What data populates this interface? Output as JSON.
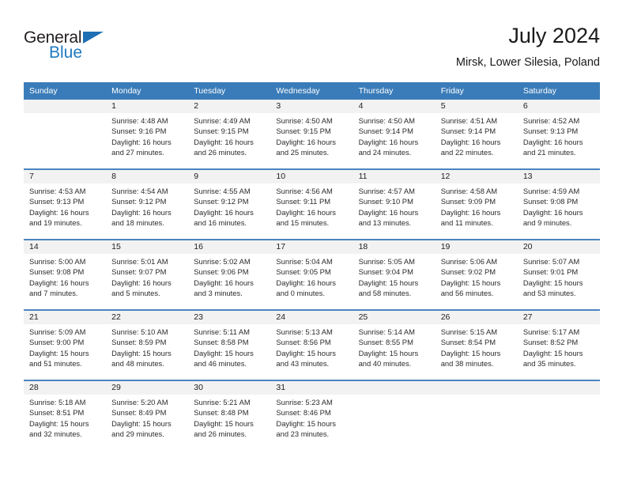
{
  "brand": {
    "name_top": "General",
    "name_bottom": "Blue",
    "triangle_color": "#1f6fb5",
    "blue_color": "#1f7ac0"
  },
  "header": {
    "title": "July 2024",
    "location": "Mirsk, Lower Silesia, Poland"
  },
  "theme": {
    "header_bg": "#3a7cb9",
    "row_rule": "#4a85bf",
    "daynum_bg": "#f2f2f2",
    "text": "#2b2b2b"
  },
  "weekdays": [
    "Sunday",
    "Monday",
    "Tuesday",
    "Wednesday",
    "Thursday",
    "Friday",
    "Saturday"
  ],
  "weeks": [
    [
      {
        "day": "",
        "sunrise": "",
        "sunset": "",
        "daylight1": "",
        "daylight2": ""
      },
      {
        "day": "1",
        "sunrise": "Sunrise: 4:48 AM",
        "sunset": "Sunset: 9:16 PM",
        "daylight1": "Daylight: 16 hours",
        "daylight2": "and 27 minutes."
      },
      {
        "day": "2",
        "sunrise": "Sunrise: 4:49 AM",
        "sunset": "Sunset: 9:15 PM",
        "daylight1": "Daylight: 16 hours",
        "daylight2": "and 26 minutes."
      },
      {
        "day": "3",
        "sunrise": "Sunrise: 4:50 AM",
        "sunset": "Sunset: 9:15 PM",
        "daylight1": "Daylight: 16 hours",
        "daylight2": "and 25 minutes."
      },
      {
        "day": "4",
        "sunrise": "Sunrise: 4:50 AM",
        "sunset": "Sunset: 9:14 PM",
        "daylight1": "Daylight: 16 hours",
        "daylight2": "and 24 minutes."
      },
      {
        "day": "5",
        "sunrise": "Sunrise: 4:51 AM",
        "sunset": "Sunset: 9:14 PM",
        "daylight1": "Daylight: 16 hours",
        "daylight2": "and 22 minutes."
      },
      {
        "day": "6",
        "sunrise": "Sunrise: 4:52 AM",
        "sunset": "Sunset: 9:13 PM",
        "daylight1": "Daylight: 16 hours",
        "daylight2": "and 21 minutes."
      }
    ],
    [
      {
        "day": "7",
        "sunrise": "Sunrise: 4:53 AM",
        "sunset": "Sunset: 9:13 PM",
        "daylight1": "Daylight: 16 hours",
        "daylight2": "and 19 minutes."
      },
      {
        "day": "8",
        "sunrise": "Sunrise: 4:54 AM",
        "sunset": "Sunset: 9:12 PM",
        "daylight1": "Daylight: 16 hours",
        "daylight2": "and 18 minutes."
      },
      {
        "day": "9",
        "sunrise": "Sunrise: 4:55 AM",
        "sunset": "Sunset: 9:12 PM",
        "daylight1": "Daylight: 16 hours",
        "daylight2": "and 16 minutes."
      },
      {
        "day": "10",
        "sunrise": "Sunrise: 4:56 AM",
        "sunset": "Sunset: 9:11 PM",
        "daylight1": "Daylight: 16 hours",
        "daylight2": "and 15 minutes."
      },
      {
        "day": "11",
        "sunrise": "Sunrise: 4:57 AM",
        "sunset": "Sunset: 9:10 PM",
        "daylight1": "Daylight: 16 hours",
        "daylight2": "and 13 minutes."
      },
      {
        "day": "12",
        "sunrise": "Sunrise: 4:58 AM",
        "sunset": "Sunset: 9:09 PM",
        "daylight1": "Daylight: 16 hours",
        "daylight2": "and 11 minutes."
      },
      {
        "day": "13",
        "sunrise": "Sunrise: 4:59 AM",
        "sunset": "Sunset: 9:08 PM",
        "daylight1": "Daylight: 16 hours",
        "daylight2": "and 9 minutes."
      }
    ],
    [
      {
        "day": "14",
        "sunrise": "Sunrise: 5:00 AM",
        "sunset": "Sunset: 9:08 PM",
        "daylight1": "Daylight: 16 hours",
        "daylight2": "and 7 minutes."
      },
      {
        "day": "15",
        "sunrise": "Sunrise: 5:01 AM",
        "sunset": "Sunset: 9:07 PM",
        "daylight1": "Daylight: 16 hours",
        "daylight2": "and 5 minutes."
      },
      {
        "day": "16",
        "sunrise": "Sunrise: 5:02 AM",
        "sunset": "Sunset: 9:06 PM",
        "daylight1": "Daylight: 16 hours",
        "daylight2": "and 3 minutes."
      },
      {
        "day": "17",
        "sunrise": "Sunrise: 5:04 AM",
        "sunset": "Sunset: 9:05 PM",
        "daylight1": "Daylight: 16 hours",
        "daylight2": "and 0 minutes."
      },
      {
        "day": "18",
        "sunrise": "Sunrise: 5:05 AM",
        "sunset": "Sunset: 9:04 PM",
        "daylight1": "Daylight: 15 hours",
        "daylight2": "and 58 minutes."
      },
      {
        "day": "19",
        "sunrise": "Sunrise: 5:06 AM",
        "sunset": "Sunset: 9:02 PM",
        "daylight1": "Daylight: 15 hours",
        "daylight2": "and 56 minutes."
      },
      {
        "day": "20",
        "sunrise": "Sunrise: 5:07 AM",
        "sunset": "Sunset: 9:01 PM",
        "daylight1": "Daylight: 15 hours",
        "daylight2": "and 53 minutes."
      }
    ],
    [
      {
        "day": "21",
        "sunrise": "Sunrise: 5:09 AM",
        "sunset": "Sunset: 9:00 PM",
        "daylight1": "Daylight: 15 hours",
        "daylight2": "and 51 minutes."
      },
      {
        "day": "22",
        "sunrise": "Sunrise: 5:10 AM",
        "sunset": "Sunset: 8:59 PM",
        "daylight1": "Daylight: 15 hours",
        "daylight2": "and 48 minutes."
      },
      {
        "day": "23",
        "sunrise": "Sunrise: 5:11 AM",
        "sunset": "Sunset: 8:58 PM",
        "daylight1": "Daylight: 15 hours",
        "daylight2": "and 46 minutes."
      },
      {
        "day": "24",
        "sunrise": "Sunrise: 5:13 AM",
        "sunset": "Sunset: 8:56 PM",
        "daylight1": "Daylight: 15 hours",
        "daylight2": "and 43 minutes."
      },
      {
        "day": "25",
        "sunrise": "Sunrise: 5:14 AM",
        "sunset": "Sunset: 8:55 PM",
        "daylight1": "Daylight: 15 hours",
        "daylight2": "and 40 minutes."
      },
      {
        "day": "26",
        "sunrise": "Sunrise: 5:15 AM",
        "sunset": "Sunset: 8:54 PM",
        "daylight1": "Daylight: 15 hours",
        "daylight2": "and 38 minutes."
      },
      {
        "day": "27",
        "sunrise": "Sunrise: 5:17 AM",
        "sunset": "Sunset: 8:52 PM",
        "daylight1": "Daylight: 15 hours",
        "daylight2": "and 35 minutes."
      }
    ],
    [
      {
        "day": "28",
        "sunrise": "Sunrise: 5:18 AM",
        "sunset": "Sunset: 8:51 PM",
        "daylight1": "Daylight: 15 hours",
        "daylight2": "and 32 minutes."
      },
      {
        "day": "29",
        "sunrise": "Sunrise: 5:20 AM",
        "sunset": "Sunset: 8:49 PM",
        "daylight1": "Daylight: 15 hours",
        "daylight2": "and 29 minutes."
      },
      {
        "day": "30",
        "sunrise": "Sunrise: 5:21 AM",
        "sunset": "Sunset: 8:48 PM",
        "daylight1": "Daylight: 15 hours",
        "daylight2": "and 26 minutes."
      },
      {
        "day": "31",
        "sunrise": "Sunrise: 5:23 AM",
        "sunset": "Sunset: 8:46 PM",
        "daylight1": "Daylight: 15 hours",
        "daylight2": "and 23 minutes."
      },
      {
        "day": "",
        "sunrise": "",
        "sunset": "",
        "daylight1": "",
        "daylight2": ""
      },
      {
        "day": "",
        "sunrise": "",
        "sunset": "",
        "daylight1": "",
        "daylight2": ""
      },
      {
        "day": "",
        "sunrise": "",
        "sunset": "",
        "daylight1": "",
        "daylight2": ""
      }
    ]
  ]
}
